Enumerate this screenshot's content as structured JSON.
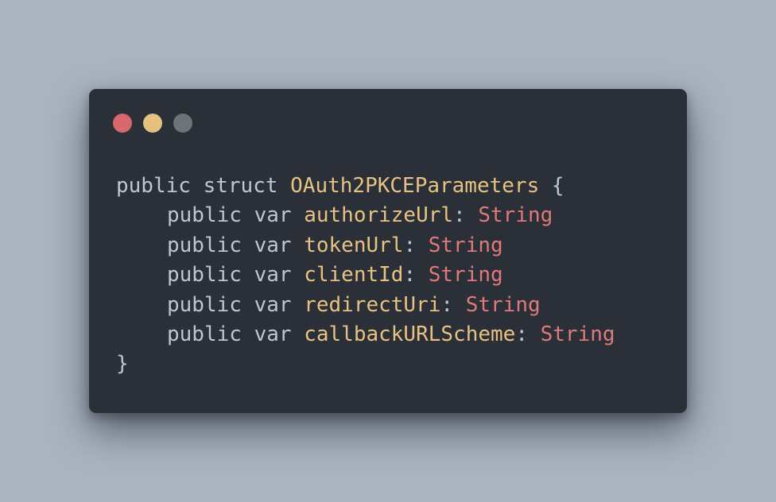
{
  "window": {
    "controls": [
      {
        "name": "close",
        "color": "#d9676c"
      },
      {
        "name": "minimize",
        "color": "#e4c27d"
      },
      {
        "name": "zoom",
        "color": "#6e7279"
      }
    ]
  },
  "colors": {
    "background": "#a9b4c0",
    "window": "#2a2f38",
    "keyword": "#c0c6cf",
    "identifier": "#e7c283",
    "type": "#de7a7a"
  },
  "code": {
    "lines": [
      {
        "indent": false,
        "tokens": [
          {
            "text": "public",
            "kind": "keyword"
          },
          {
            "text": " ",
            "kind": "space"
          },
          {
            "text": "struct",
            "kind": "keyword"
          },
          {
            "text": " ",
            "kind": "space"
          },
          {
            "text": "OAuth2PKCEParameters",
            "kind": "identifier"
          },
          {
            "text": " ",
            "kind": "space"
          },
          {
            "text": "{",
            "kind": "punctuation"
          }
        ]
      },
      {
        "indent": true,
        "tokens": [
          {
            "text": "public",
            "kind": "keyword"
          },
          {
            "text": " ",
            "kind": "space"
          },
          {
            "text": "var",
            "kind": "keyword"
          },
          {
            "text": " ",
            "kind": "space"
          },
          {
            "text": "authorizeUrl",
            "kind": "identifier"
          },
          {
            "text": ": ",
            "kind": "punctuation"
          },
          {
            "text": "String",
            "kind": "type"
          }
        ]
      },
      {
        "indent": true,
        "tokens": [
          {
            "text": "public",
            "kind": "keyword"
          },
          {
            "text": " ",
            "kind": "space"
          },
          {
            "text": "var",
            "kind": "keyword"
          },
          {
            "text": " ",
            "kind": "space"
          },
          {
            "text": "tokenUrl",
            "kind": "identifier"
          },
          {
            "text": ": ",
            "kind": "punctuation"
          },
          {
            "text": "String",
            "kind": "type"
          }
        ]
      },
      {
        "indent": true,
        "tokens": [
          {
            "text": "public",
            "kind": "keyword"
          },
          {
            "text": " ",
            "kind": "space"
          },
          {
            "text": "var",
            "kind": "keyword"
          },
          {
            "text": " ",
            "kind": "space"
          },
          {
            "text": "clientId",
            "kind": "identifier"
          },
          {
            "text": ": ",
            "kind": "punctuation"
          },
          {
            "text": "String",
            "kind": "type"
          }
        ]
      },
      {
        "indent": true,
        "tokens": [
          {
            "text": "public",
            "kind": "keyword"
          },
          {
            "text": " ",
            "kind": "space"
          },
          {
            "text": "var",
            "kind": "keyword"
          },
          {
            "text": " ",
            "kind": "space"
          },
          {
            "text": "redirectUri",
            "kind": "identifier"
          },
          {
            "text": ": ",
            "kind": "punctuation"
          },
          {
            "text": "String",
            "kind": "type"
          }
        ]
      },
      {
        "indent": true,
        "tokens": [
          {
            "text": "public",
            "kind": "keyword"
          },
          {
            "text": " ",
            "kind": "space"
          },
          {
            "text": "var",
            "kind": "keyword"
          },
          {
            "text": " ",
            "kind": "space"
          },
          {
            "text": "callbackURLScheme",
            "kind": "identifier"
          },
          {
            "text": ": ",
            "kind": "punctuation"
          },
          {
            "text": "String",
            "kind": "type"
          }
        ]
      },
      {
        "indent": false,
        "tokens": [
          {
            "text": "}",
            "kind": "punctuation"
          }
        ]
      }
    ]
  }
}
